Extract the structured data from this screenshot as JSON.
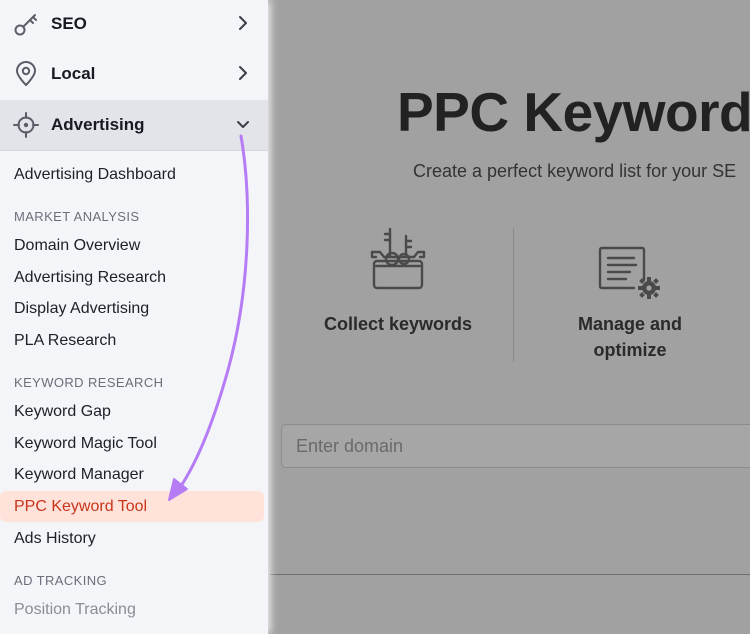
{
  "sidebar": {
    "top_items": [
      {
        "label": "SEO",
        "icon": "key-icon"
      },
      {
        "label": "Local",
        "icon": "map-pin-icon"
      },
      {
        "label": "Advertising",
        "icon": "crosshair-icon"
      }
    ],
    "dashboard": "Advertising Dashboard",
    "market_analysis": {
      "heading": "MARKET ANALYSIS",
      "items": [
        "Domain Overview",
        "Advertising Research",
        "Display Advertising",
        "PLA Research"
      ]
    },
    "keyword_research": {
      "heading": "KEYWORD RESEARCH",
      "items": [
        "Keyword Gap",
        "Keyword Magic Tool",
        "Keyword Manager",
        "PPC Keyword Tool",
        "Ads History"
      ]
    },
    "ad_tracking": {
      "heading": "AD TRACKING",
      "items": [
        "Position Tracking"
      ]
    },
    "selected_item": "PPC Keyword Tool"
  },
  "main": {
    "title": "PPC Keyword",
    "subtitle": "Create a perfect keyword list for your SE",
    "features": [
      {
        "label": "Collect keywords",
        "icon": "keys-basket-icon"
      },
      {
        "label": "Manage and optimize",
        "icon": "settings-document-icon"
      }
    ],
    "domain_input": {
      "placeholder": "Enter domain",
      "value": ""
    }
  },
  "colors": {
    "selected_bg": "#ffe3da",
    "selected_text": "#c8351a",
    "arrow": "#b57cf5",
    "overlay": "#a1a1a1"
  }
}
